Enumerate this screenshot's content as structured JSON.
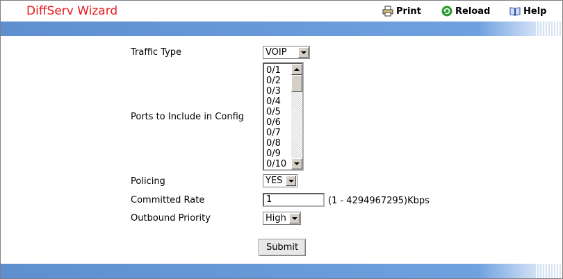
{
  "header": {
    "title": "DiffServ Wizard",
    "print_label": "Print",
    "reload_label": "Reload",
    "help_label": "Help"
  },
  "form": {
    "traffic_type": {
      "label": "Traffic Type",
      "value": "VOIP"
    },
    "ports": {
      "label": "Ports to Include in Config",
      "options": [
        "0/1",
        "0/2",
        "0/3",
        "0/4",
        "0/5",
        "0/6",
        "0/7",
        "0/8",
        "0/9",
        "0/10"
      ]
    },
    "policing": {
      "label": "Policing",
      "value": "YES"
    },
    "committed_rate": {
      "label": "Committed Rate",
      "value": "1",
      "hint": "(1 - 4294967295)Kbps"
    },
    "outbound_priority": {
      "label": "Outbound Priority",
      "value": "High"
    },
    "submit_label": "Submit"
  },
  "colors": {
    "title": "#e8191c",
    "bar": "#6fa0e0"
  }
}
